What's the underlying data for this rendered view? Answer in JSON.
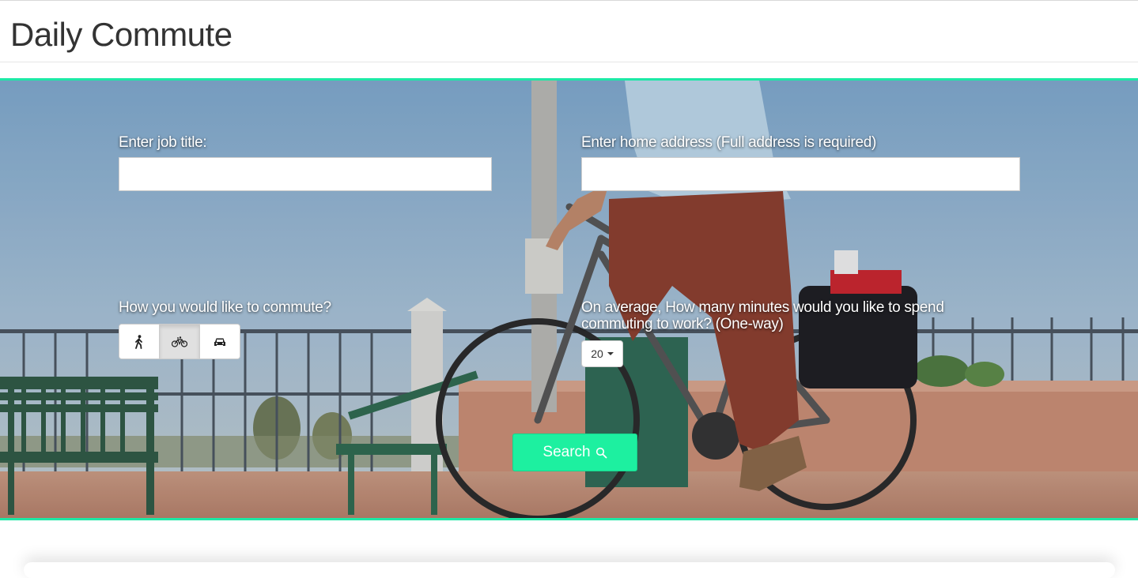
{
  "header": {
    "title": "Daily Commute"
  },
  "form": {
    "job_title": {
      "label": "Enter job title:",
      "value": "",
      "placeholder": ""
    },
    "home_address": {
      "label": "Enter home address (Full address is required)",
      "value": "",
      "placeholder": ""
    },
    "commute_mode": {
      "label": "How you would like to commute?",
      "options": [
        {
          "icon": "walking-icon",
          "selected": false
        },
        {
          "icon": "bicycle-icon",
          "selected": true
        },
        {
          "icon": "car-icon",
          "selected": false
        }
      ]
    },
    "minutes": {
      "label": "On average, How many minutes would you like to spend commuting to work? (One-way)",
      "selected": "20"
    },
    "search_label": "Search"
  },
  "colors": {
    "accent": "#1de9a6",
    "button": "#1df0a0"
  }
}
